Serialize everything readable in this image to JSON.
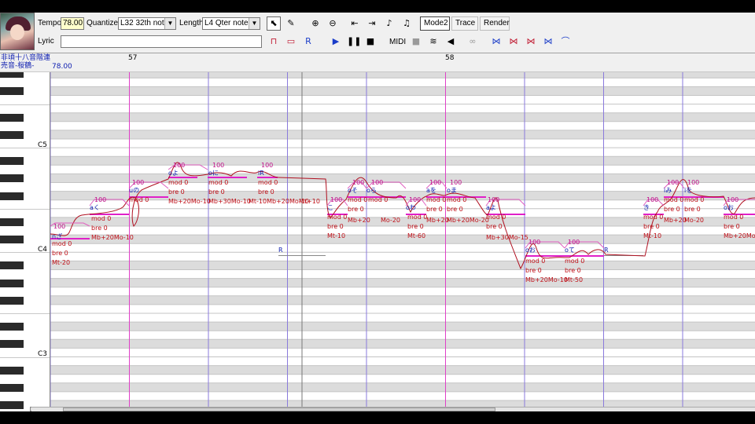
{
  "toolbar": {
    "tempo_label": "Tempo",
    "tempo_value": "78.00",
    "quantize_label": "Quantize",
    "quantize_value": "L32 32th note",
    "length_label": "Length",
    "length_value": "L4  Qter note",
    "lyric_label": "Lyric",
    "lyric_value": "",
    "mode2_label": "Mode2",
    "trace_label": "Trace",
    "render_label": "Render",
    "midi_label": "MIDI",
    "icons": [
      "arrow-select-icon",
      "pencil-icon",
      "zoom-in-icon",
      "zoom-out-icon",
      "go-start-icon",
      "go-end-icon",
      "note-prev-icon",
      "note-next-icon",
      "note-insert-icon",
      "note-split-icon",
      "rest-insert-icon",
      "play-icon",
      "pause-icon",
      "stop-icon",
      "record-icon",
      "metronome-icon",
      "speaker-icon",
      "loop-icon",
      "tool-1-icon",
      "tool-2-icon",
      "tool-3-icon",
      "tool-4-icon",
      "tool-5-icon"
    ]
  },
  "ruler": {
    "voice_name_1": "非頃十八音階連",
    "voice_name_2": "売音-桜鶴-",
    "tempo_mark": "78.00",
    "bars": [
      "57",
      "58"
    ]
  },
  "piano": {
    "octaves": [
      "C5",
      "C4",
      "C3"
    ]
  },
  "notes": [
    {
      "lyric": "nざ",
      "vel": "100",
      "mod": "mod 0",
      "bre": "bre 0",
      "extra": "Mt-20"
    },
    {
      "lyric": "aく",
      "vel": "100",
      "mod": "mod 0",
      "bre": "bre 0",
      "extra": "Mb+20Mo-10"
    },
    {
      "lyric": "uの",
      "vel": "100",
      "mod": "mod 0",
      "bre": "",
      "extra": ""
    },
    {
      "lyric": "oよ",
      "vel": "100",
      "mod": "mod 0",
      "bre": "bre 0",
      "extra": "Mb+20Mo-10"
    },
    {
      "lyric": "oに",
      "vel": "100",
      "mod": "mod 0",
      "bre": "bre 0",
      "extra": "Mb+30Mo-10"
    },
    {
      "lyric": "iR",
      "vel": "100",
      "mod": "mod 0",
      "bre": "bre 0",
      "extra": "Mt-10Mb+20Mo-10"
    },
    {
      "lyric": "Mt+10",
      "vel": "",
      "mod": "",
      "bre": "",
      "extra": ""
    },
    {
      "lyric": "R",
      "vel": "",
      "mod": "",
      "bre": "",
      "extra": ""
    },
    {
      "lyric": "こ",
      "vel": "100",
      "mod": "mod 0",
      "bre": "bre 0",
      "extra": "Mt-10"
    },
    {
      "lyric": "oそ",
      "vel": "100",
      "mod": "mod 0",
      "bre": "bre 0",
      "extra": "Mb+20"
    },
    {
      "lyric": "oら",
      "vel": "100",
      "mod": "mod 0",
      "bre": "",
      "extra": "Mo-20"
    },
    {
      "lyric": "oわ",
      "vel": "100",
      "mod": "mod 0",
      "bre": "bre 0",
      "extra": "Mt-60"
    },
    {
      "lyric": "aを",
      "vel": "100",
      "mod": "mod 0",
      "bre": "bre 0",
      "extra": "Mb+20"
    },
    {
      "lyric": "oま",
      "vel": "100",
      "mod": "mod 0",
      "bre": "bre 0",
      "extra": "Mb+20Mo-20"
    },
    {
      "lyric": "aよ",
      "vel": "100",
      "mod": "mod 0",
      "bre": "bre 0",
      "extra": "Mb+30Mo-15"
    },
    {
      "lyric": "oお",
      "vel": "100",
      "mod": "mod 0",
      "bre": "bre 0",
      "extra": "Mb+20Mo-10"
    },
    {
      "lyric": "oて",
      "vel": "100",
      "mod": "mod 0",
      "bre": "bre 0",
      "extra": "Mt-50"
    },
    {
      "lyric": "R",
      "vel": "",
      "mod": "",
      "bre": "",
      "extra": ""
    },
    {
      "lyric": "き",
      "vel": "100",
      "mod": "mod 0",
      "bre": "bre 0",
      "extra": "Mt-10"
    },
    {
      "lyric": "iみ",
      "vel": "100",
      "mod": "mod 0",
      "bre": "bre 0",
      "extra": "Mb+20"
    },
    {
      "lyric": "iを",
      "vel": "100",
      "mod": "mod 0",
      "bre": "bre 0",
      "extra": "Mo-20"
    },
    {
      "lyric": "oお",
      "vel": "100",
      "mod": "mod 0",
      "bre": "bre 0",
      "extra": "Mb+20Mo-20"
    }
  ]
}
